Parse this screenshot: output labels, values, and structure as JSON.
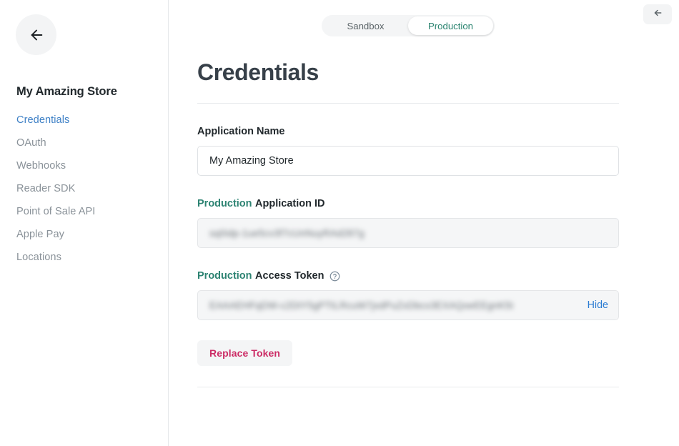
{
  "sidebar": {
    "back_icon": "arrow-left-icon",
    "store_title": "My Amazing Store",
    "items": [
      {
        "label": "Credentials",
        "active": true
      },
      {
        "label": "OAuth",
        "active": false
      },
      {
        "label": "Webhooks",
        "active": false
      },
      {
        "label": "Reader SDK",
        "active": false
      },
      {
        "label": "Point of Sale API",
        "active": false
      },
      {
        "label": "Apple Pay",
        "active": false
      },
      {
        "label": "Locations",
        "active": false
      }
    ]
  },
  "header": {
    "back_button_icon": "arrow-left-icon",
    "env_toggle": {
      "options": [
        "Sandbox",
        "Production"
      ],
      "selected": "Production"
    }
  },
  "main": {
    "page_title": "Credentials",
    "application_name": {
      "label": "Application Name",
      "value": "My Amazing Store",
      "placeholder": "Application Name"
    },
    "application_id": {
      "label_env": "Production",
      "label_rest": "Application ID",
      "value": "sq0idp-1ue5cv3f7cUnNuyRAd287g",
      "masked": true
    },
    "access_token": {
      "label_env": "Production",
      "label_rest": "Access Token",
      "help_icon": "question-circle-icon",
      "value": "EAAAEHFqDW-c2DtY5gPTtLRcuW7jxdPuZxDbcx3EXAQoeEEgnK5t",
      "masked": true,
      "toggle_label": "Hide"
    },
    "replace_token_label": "Replace Token"
  },
  "colors": {
    "accent_link": "#3f81c6",
    "env_production": "#2d8372",
    "danger": "#cc2c65",
    "hide_link": "#2b7cd3",
    "muted_text": "#8a9299"
  }
}
